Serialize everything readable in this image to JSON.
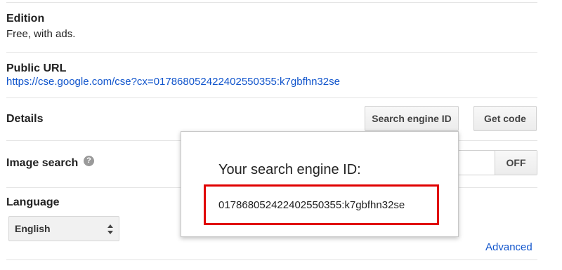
{
  "edition": {
    "label": "Edition",
    "value": "Free, with ads."
  },
  "public_url": {
    "label": "Public URL",
    "url": "https://cse.google.com/cse?cx=017868052422402550355:k7gbfhn32se"
  },
  "details": {
    "label": "Details",
    "search_engine_id_button": "Search engine ID",
    "get_code_button": "Get code"
  },
  "image_search": {
    "label": "Image search",
    "help_icon": "question-icon",
    "toggle_state": "OFF"
  },
  "language": {
    "label": "Language",
    "selected": "English"
  },
  "advanced_link": "Advanced",
  "popup": {
    "title": "Your search engine ID:",
    "engine_id": "017868052422402550355:k7gbfhn32se",
    "highlight_color": "#e00000"
  },
  "colors": {
    "link": "#1155cc",
    "text": "#222222"
  }
}
